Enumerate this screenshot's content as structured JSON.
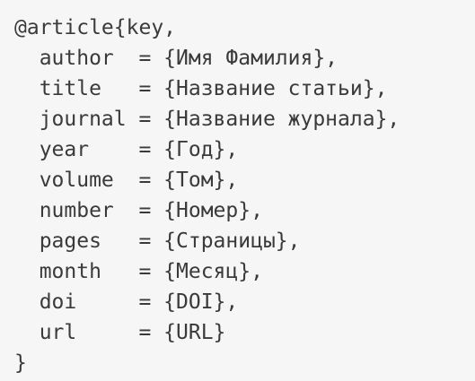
{
  "code": {
    "lines": [
      "@article{key,",
      "  author  = {Имя Фамилия},",
      "  title   = {Название статьи},",
      "  journal = {Название журнала},",
      "  year    = {Год},",
      "  volume  = {Том},",
      "  number  = {Номер},",
      "  pages   = {Страницы},",
      "  month   = {Месяц},",
      "  doi     = {DOI},",
      "  url     = {URL}",
      "}"
    ]
  }
}
